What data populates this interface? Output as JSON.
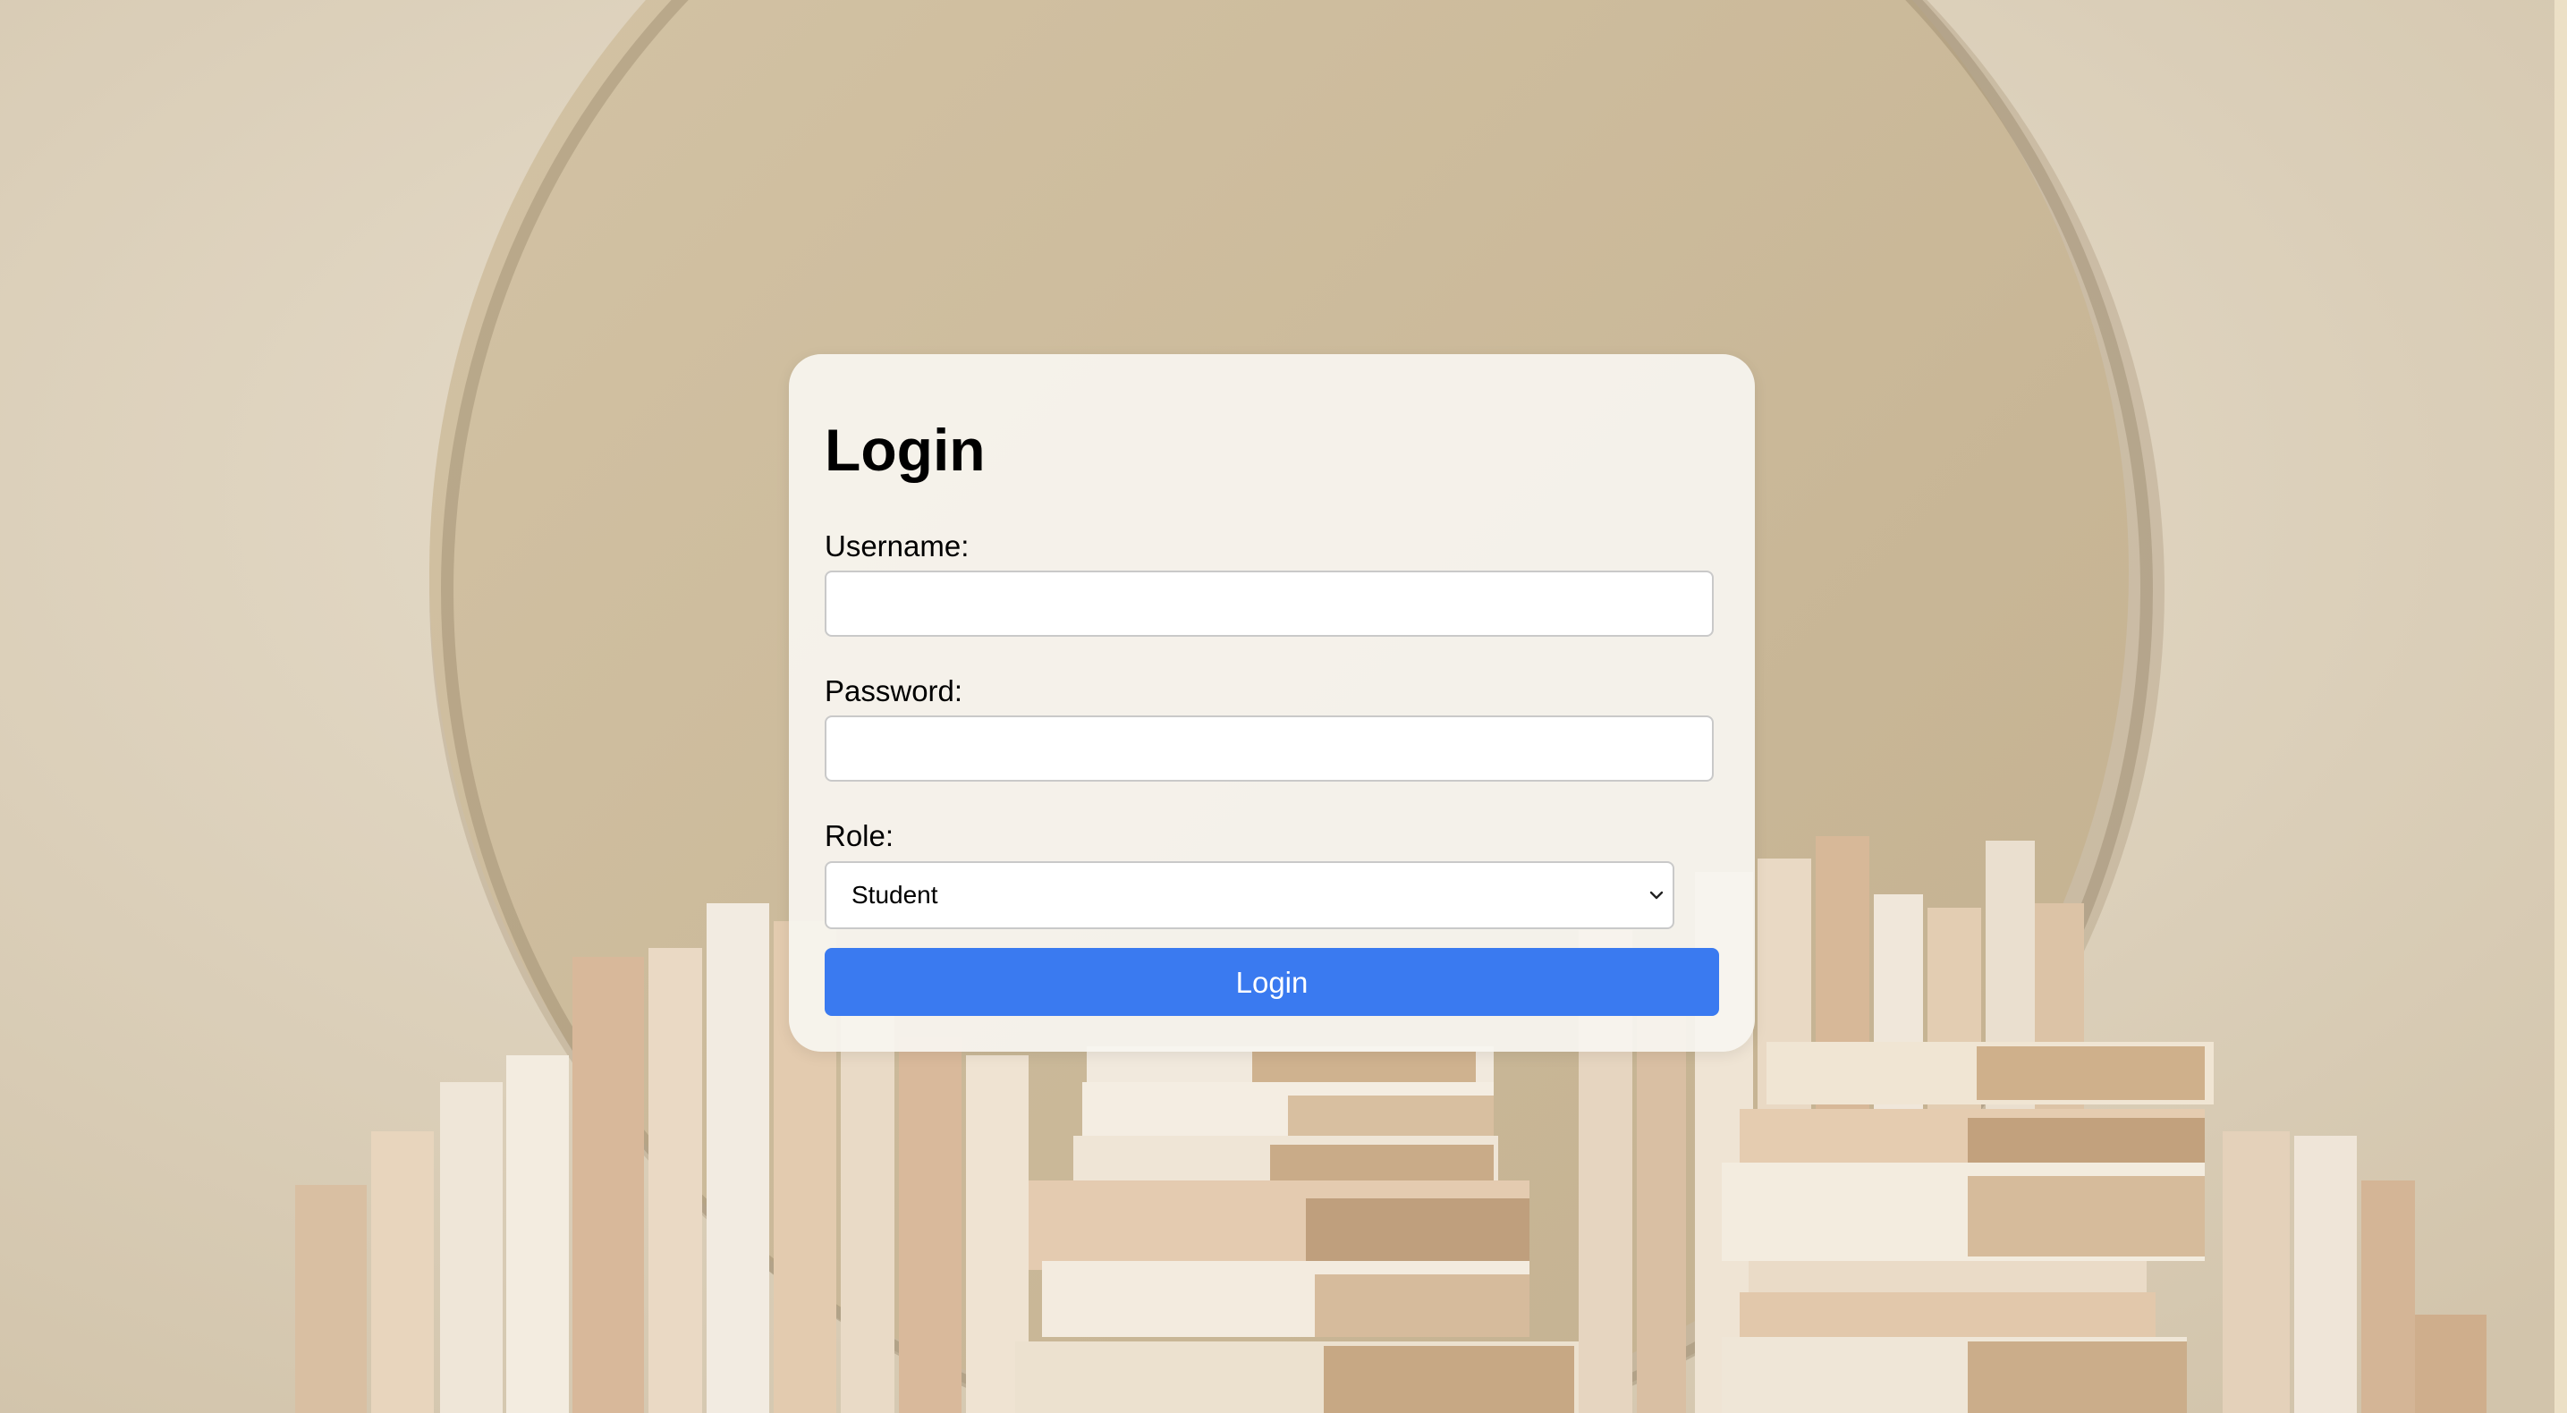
{
  "login_form": {
    "title": "Login",
    "username_label": "Username:",
    "username_value": "",
    "password_label": "Password:",
    "password_value": "",
    "role_label": "Role:",
    "role_selected": "Student",
    "submit_label": "Login"
  },
  "colors": {
    "button_background": "#3a7af0",
    "button_text": "#ffffff",
    "card_background": "#f8f5f0",
    "page_background": "#ded2bd"
  },
  "icons": {
    "select_arrow": "chevron-down-icon"
  }
}
